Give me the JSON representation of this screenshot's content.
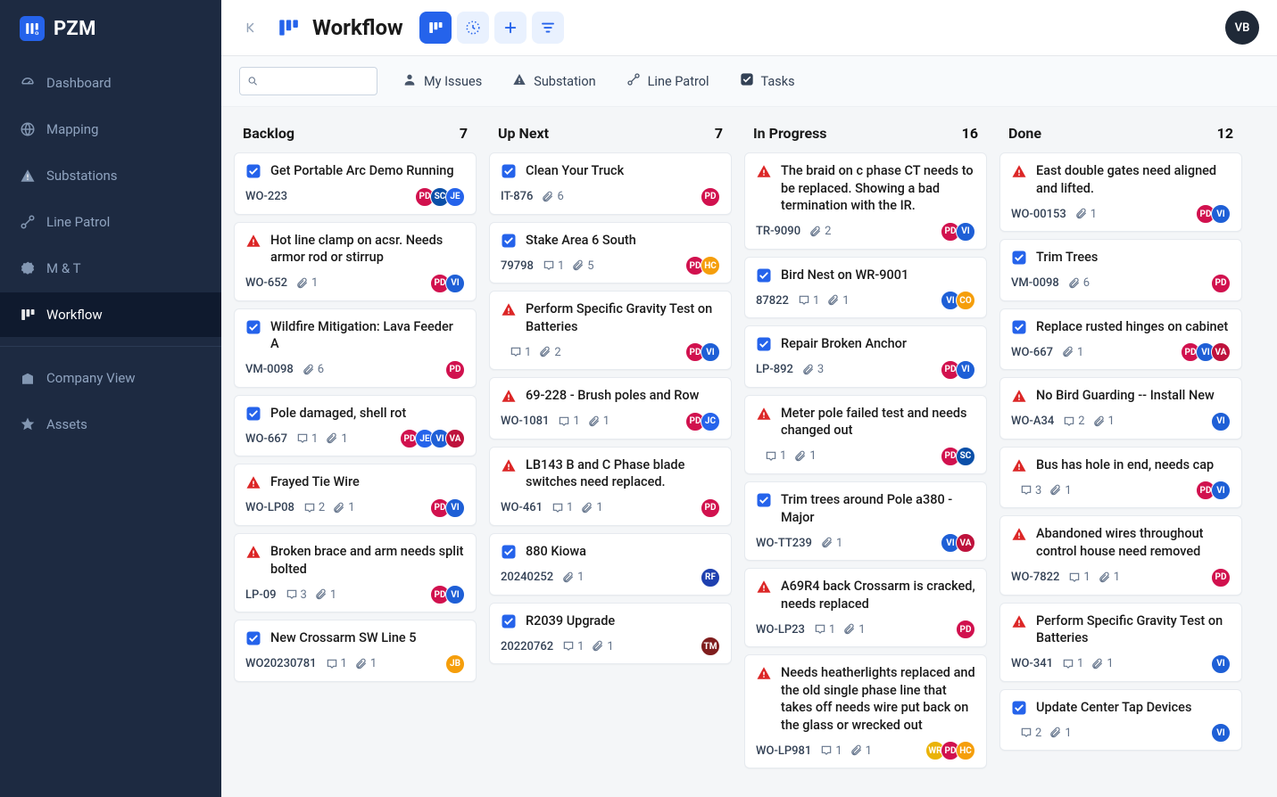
{
  "brand": {
    "name": "PZM"
  },
  "user_avatar": "VB",
  "page_title": "Workflow",
  "sidebar": {
    "items_top": [
      {
        "label": "Dashboard",
        "icon": "dashboard-icon"
      },
      {
        "label": "Mapping",
        "icon": "globe-icon"
      },
      {
        "label": "Substations",
        "icon": "warning-icon"
      },
      {
        "label": "Line Patrol",
        "icon": "route-icon"
      },
      {
        "label": "M & T",
        "icon": "badge-icon"
      },
      {
        "label": "Workflow",
        "icon": "board-icon",
        "active": true
      }
    ],
    "items_bottom": [
      {
        "label": "Company View",
        "icon": "building-icon"
      },
      {
        "label": "Assets",
        "icon": "star-icon"
      }
    ]
  },
  "filters": [
    {
      "label": "My Issues",
      "icon": "user-icon"
    },
    {
      "label": "Substation",
      "icon": "warning-icon"
    },
    {
      "label": "Line Patrol",
      "icon": "route-icon"
    },
    {
      "label": "Tasks",
      "icon": "check-icon"
    }
  ],
  "columns": [
    {
      "title": "Backlog",
      "count": 7,
      "cards": [
        {
          "type": "task",
          "title": "Get Portable Arc Demo Running",
          "id": "WO-223",
          "assignees": [
            "PD",
            "SC",
            "JE"
          ]
        },
        {
          "type": "alert",
          "title": "Hot line clamp on acsr. Needs armor rod or stirrup",
          "id": "WO-652",
          "attachments": 1,
          "assignees": [
            "PD",
            "VI"
          ]
        },
        {
          "type": "task",
          "title": "Wildfire Mitigation: Lava Feeder A",
          "id": "VM-0098",
          "attachments": 6,
          "assignees": [
            "PD"
          ]
        },
        {
          "type": "task",
          "title": "Pole damaged, shell rot",
          "id": "WO-667",
          "comments": 1,
          "attachments": 1,
          "assignees": [
            "PD",
            "JE",
            "VI",
            "VA"
          ]
        },
        {
          "type": "alert",
          "title": "Frayed Tie Wire",
          "id": "WO-LP08",
          "comments": 2,
          "attachments": 1,
          "assignees": [
            "PD",
            "VI"
          ]
        },
        {
          "type": "alert",
          "title": "Broken brace and arm needs split bolted",
          "id": "LP-09",
          "comments": 3,
          "attachments": 1,
          "assignees": [
            "PD",
            "VI"
          ]
        },
        {
          "type": "task",
          "title": " New Crossarm SW Line 5",
          "id": "WO20230781",
          "comments": 1,
          "attachments": 1,
          "assignees": [
            "JB"
          ]
        }
      ]
    },
    {
      "title": "Up Next",
      "count": 7,
      "cards": [
        {
          "type": "task",
          "title": "Clean Your Truck",
          "id": "IT-876",
          "attachments": 6,
          "assignees": [
            "PD"
          ]
        },
        {
          "type": "task",
          "title": "Stake Area 6 South",
          "id": "79798",
          "comments": 1,
          "attachments": 5,
          "assignees": [
            "PD",
            "HC"
          ]
        },
        {
          "type": "alert",
          "title": "Perform Specific Gravity Test on Batteries",
          "id": "",
          "comments": 1,
          "attachments": 2,
          "assignees": [
            "PD",
            "VI"
          ]
        },
        {
          "type": "alert",
          "title": "69-228 - Brush poles and Row",
          "id": "WO-1081",
          "comments": 1,
          "attachments": 1,
          "assignees": [
            "PD",
            "JC"
          ]
        },
        {
          "type": "alert",
          "title": "LB143 B and C Phase blade switches need replaced.",
          "id": "WO-461",
          "comments": 1,
          "attachments": 1,
          "assignees": [
            "PD"
          ]
        },
        {
          "type": "task",
          "title": "880 Kiowa",
          "id": "20240252",
          "attachments": 1,
          "assignees": [
            "RF"
          ]
        },
        {
          "type": "task",
          "title": "R2039 Upgrade",
          "id": "20220762",
          "comments": 1,
          "attachments": 1,
          "assignees": [
            "TM"
          ]
        }
      ]
    },
    {
      "title": "In Progress",
      "count": 16,
      "cards": [
        {
          "type": "alert",
          "title": "The braid on c phase CT needs to be replaced. Showing a bad termination with the IR.",
          "id": "TR-9090",
          "attachments": 2,
          "assignees": [
            "PD",
            "VI"
          ]
        },
        {
          "type": "task",
          "title": "Bird Nest on WR-9001",
          "id": "87822",
          "comments": 1,
          "attachments": 1,
          "assignees": [
            "VI",
            "CO"
          ]
        },
        {
          "type": "task",
          "title": "Repair Broken Anchor",
          "id": "LP-892",
          "attachments": 3,
          "assignees": [
            "PD",
            "VI"
          ]
        },
        {
          "type": "alert",
          "title": "Meter pole failed test and needs changed out",
          "id": "",
          "comments": 1,
          "attachments": 1,
          "assignees": [
            "PD",
            "SC"
          ]
        },
        {
          "type": "task",
          "title": "Trim trees around Pole a380 - Major",
          "id": "WO-TT239",
          "attachments": 1,
          "assignees": [
            "VI",
            "VA"
          ]
        },
        {
          "type": "alert",
          "title": "A69R4 back Crossarm is cracked, needs replaced",
          "id": "WO-LP23",
          "comments": 1,
          "attachments": 1,
          "assignees": [
            "PD"
          ]
        },
        {
          "type": "alert",
          "title": "Needs heatherlights replaced and the old single phase line that takes off needs wire put back on the glass or wrecked out",
          "id": "WO-LP981",
          "comments": 1,
          "attachments": 1,
          "assignees": [
            "WR",
            "PD",
            "HC"
          ]
        }
      ]
    },
    {
      "title": "Done",
      "count": 12,
      "cards": [
        {
          "type": "alert",
          "title": "East double gates need aligned and lifted.",
          "id": "WO-00153",
          "attachments": 1,
          "assignees": [
            "PD",
            "VI"
          ]
        },
        {
          "type": "task",
          "title": "Trim Trees",
          "id": "VM-0098",
          "attachments": 6,
          "assignees": [
            "PD"
          ]
        },
        {
          "type": "task",
          "title": "Replace rusted hinges on cabinet",
          "id": "WO-667",
          "attachments": 1,
          "assignees": [
            "PD",
            "VI",
            "VA"
          ]
        },
        {
          "type": "alert",
          "title": "No Bird Guarding -- Install New",
          "id": "WO-A34",
          "comments": 2,
          "attachments": 1,
          "assignees": [
            "VI"
          ]
        },
        {
          "type": "alert",
          "title": "Bus has hole in end, needs cap",
          "id": "",
          "comments": 3,
          "attachments": 1,
          "assignees": [
            "PD",
            "VI"
          ]
        },
        {
          "type": "alert",
          "title": "Abandoned wires throughout control house need removed",
          "id": "WO-7822",
          "comments": 1,
          "attachments": 1,
          "assignees": [
            "PD"
          ]
        },
        {
          "type": "alert",
          "title": "Perform Specific Gravity Test on Batteries",
          "id": "WO-341",
          "comments": 1,
          "attachments": 1,
          "assignees": [
            "VI"
          ]
        },
        {
          "type": "task",
          "title": "Update Center Tap Devices",
          "id": "",
          "comments": 2,
          "attachments": 1,
          "assignees": [
            "VI"
          ]
        }
      ]
    }
  ]
}
